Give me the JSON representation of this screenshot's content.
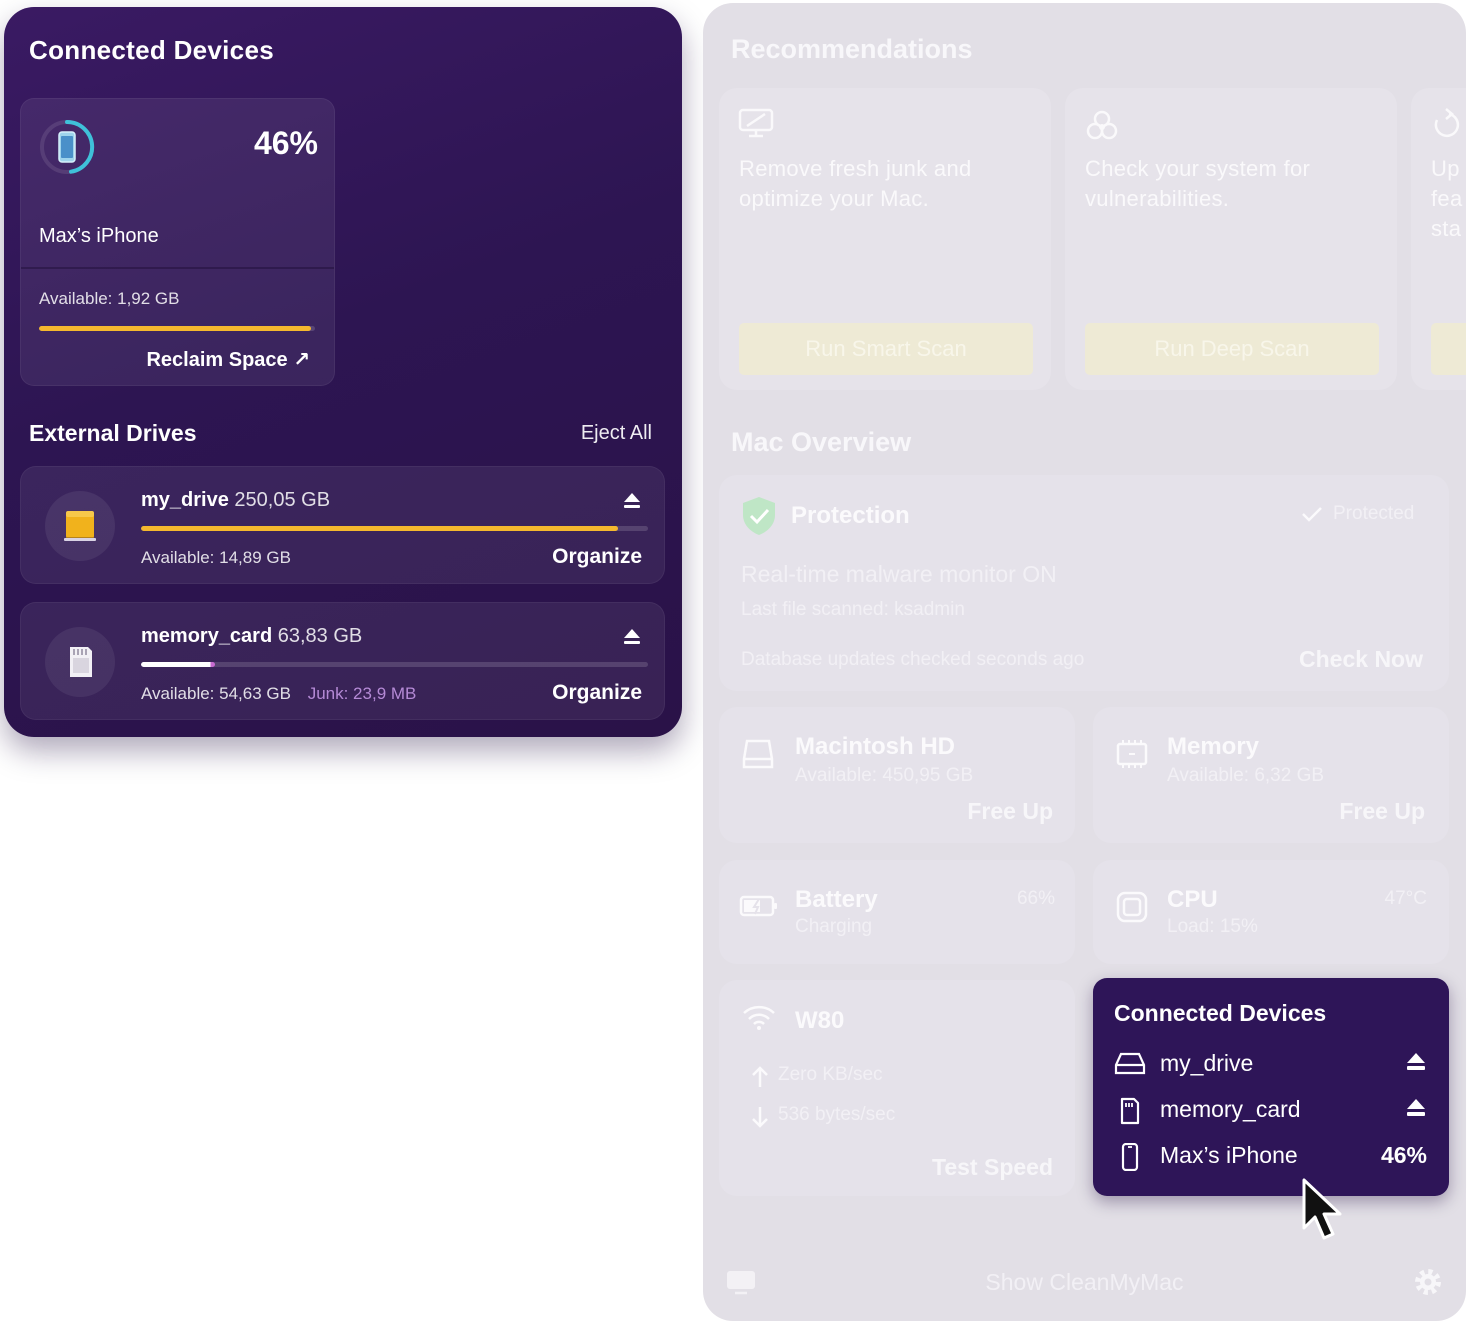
{
  "left_panel": {
    "title": "Connected Devices",
    "device": {
      "percent": "46%",
      "name": "Max’s iPhone",
      "available": "Available: 1,92 GB",
      "usage_fraction": 0.985,
      "reclaim_label": "Reclaim Space ↗"
    },
    "external": {
      "title": "External Drives",
      "eject_all": "Eject All",
      "drives": [
        {
          "name": "my_drive",
          "size": "250,05 GB",
          "available": "Available: 14,89 GB",
          "junk": "",
          "usage_fraction": 0.94,
          "action": "Organize"
        },
        {
          "name": "memory_card",
          "size": "63,83 GB",
          "available": "Available: 54,63 GB",
          "junk": "Junk: 23,9 MB",
          "usage_fraction": 0.145,
          "action": "Organize"
        }
      ]
    }
  },
  "right_panel": {
    "recommendations_title": "Recommendations",
    "recommendations": [
      {
        "icon": "monitor-cleanup-icon",
        "text": "Remove fresh junk and optimize your Mac.",
        "button": "Run Smart Scan"
      },
      {
        "icon": "biohazard-icon",
        "text": "Check your system for vulnerabilities.",
        "button": "Run Deep Scan"
      },
      {
        "icon": "update-icon",
        "text": "Up fea sta",
        "button": ""
      }
    ],
    "overview_title": "Mac Overview",
    "protection": {
      "label": "Protection",
      "status": "Protected",
      "headline": "Real-time malware monitor ON",
      "last_scanned": "Last file scanned: ksadmin",
      "db_updates": "Database updates checked seconds ago",
      "action": "Check Now"
    },
    "disk": {
      "label": "Macintosh HD",
      "sub": "Available: 450,95 GB",
      "action": "Free Up"
    },
    "memory": {
      "label": "Memory",
      "sub": "Available: 6,32 GB",
      "action": "Free Up"
    },
    "battery": {
      "label": "Battery",
      "sub": "Charging",
      "value": "66%"
    },
    "cpu": {
      "label": "CPU",
      "sub": "Load: 15%",
      "value": "47°C"
    },
    "network": {
      "label": "W80",
      "upload": "Zero KB/sec",
      "download": "536 bytes/sec",
      "action": "Test Speed"
    },
    "footer": {
      "label": "Show CleanMyMac"
    }
  },
  "popup": {
    "title": "Connected Devices",
    "items": [
      {
        "name": "my_drive",
        "icon": "external-drive-icon",
        "right": "eject"
      },
      {
        "name": "memory_card",
        "icon": "sd-card-icon",
        "right": "eject"
      },
      {
        "name": "Max’s iPhone",
        "icon": "iphone-icon",
        "value": "46%"
      }
    ]
  },
  "colors": {
    "panel_purple": "#2d1552",
    "accent_yellow": "#f5b82e",
    "ring_cyan": "#3fc1d9",
    "junk_purple": "#b58ad6",
    "faded_panel": "#e2dfe6"
  }
}
